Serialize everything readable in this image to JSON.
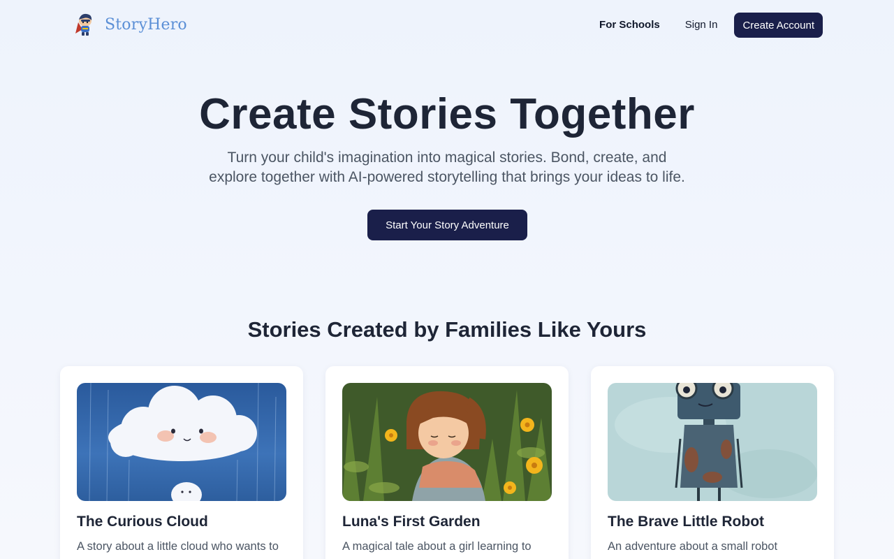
{
  "brand": {
    "name": "StoryHero",
    "logo_icon": "superhero-kid-icon"
  },
  "nav": {
    "for_schools": "For Schools",
    "sign_in": "Sign In",
    "create_account": "Create Account"
  },
  "hero": {
    "title": "Create Stories Together",
    "subtitle": "Turn your child's imagination into magical stories. Bond, create, and explore together with AI-powered storytelling that brings your ideas to life.",
    "cta": "Start Your Story Adventure"
  },
  "stories_section": {
    "title": "Stories Created by Families Like Yours",
    "cards": [
      {
        "title": "The Curious Cloud",
        "description": "A story about a little cloud who wants to",
        "image": "smiling-cloud-illustration"
      },
      {
        "title": "Luna's First Garden",
        "description": "A magical tale about a girl learning to",
        "image": "girl-in-garden-illustration"
      },
      {
        "title": "The Brave Little Robot",
        "description": "An adventure about a small robot learning",
        "image": "rusty-robot-illustration"
      }
    ]
  },
  "colors": {
    "primary_button": "#1a1f4a",
    "brand_text": "#5b8fd6",
    "heading": "#1e2536",
    "body_text": "#4b5563"
  }
}
